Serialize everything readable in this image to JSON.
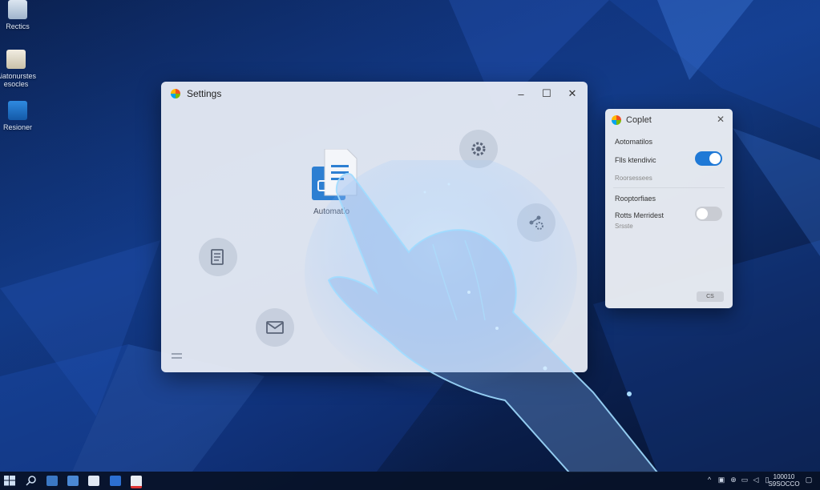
{
  "desktop": {
    "icons": [
      {
        "label": "Rectics"
      },
      {
        "label": "Aiatonurstes\nesocles"
      },
      {
        "label": "Resioner"
      }
    ]
  },
  "settings_window": {
    "title": "Settings",
    "automation_label": "Automatio",
    "controls": {
      "minimize": "–",
      "maximize": "☐",
      "close": "✕"
    }
  },
  "copilot": {
    "title": "Coplet",
    "section1": "Aotomatilos",
    "row1": "Flls ktendivic",
    "row1_sub": "Roorsessees",
    "section2": "Rooptorfiaes",
    "row2": "Rotts Merridest",
    "row2_sub": "Srsste",
    "button": "CS",
    "toggle1_on": true,
    "toggle2_on": false
  },
  "taskbar": {
    "clock_line1": "100010",
    "clock_line2": "S9SOCCO"
  },
  "colors": {
    "accent": "#1f79d6",
    "desktop_dark": "#0b2150",
    "desktop_mid": "#123a84"
  }
}
